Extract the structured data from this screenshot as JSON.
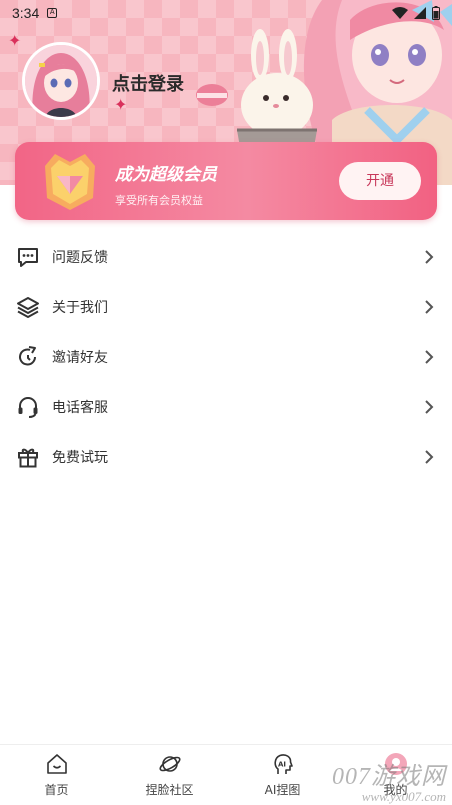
{
  "status_bar": {
    "time": "3:34",
    "notif": "A"
  },
  "profile": {
    "login_label": "点击登录"
  },
  "vip": {
    "title": "成为超级会员",
    "subtitle": "享受所有会员权益",
    "button_label": "开通",
    "badge_letter": "V"
  },
  "menu": [
    {
      "label": "问题反馈",
      "icon": "feedback-icon"
    },
    {
      "label": "关于我们",
      "icon": "layers-icon"
    },
    {
      "label": "邀请好友",
      "icon": "refresh-icon"
    },
    {
      "label": "电话客服",
      "icon": "headset-icon"
    },
    {
      "label": "免费试玩",
      "icon": "gift-icon"
    }
  ],
  "bottom_nav": [
    {
      "label": "首页",
      "icon": "home-icon"
    },
    {
      "label": "捏脸社区",
      "icon": "planet-icon"
    },
    {
      "label": "AI捏图",
      "icon": "ai-icon"
    },
    {
      "label": "我的",
      "icon": "profile-icon"
    }
  ],
  "ai_icon_text": "AI",
  "watermark": {
    "line1": "007游戏网",
    "line2": "www.yx007.com"
  },
  "colors": {
    "accent": "#f26586",
    "header_bg": "#f7b6bf",
    "button_text": "#c8375a"
  }
}
